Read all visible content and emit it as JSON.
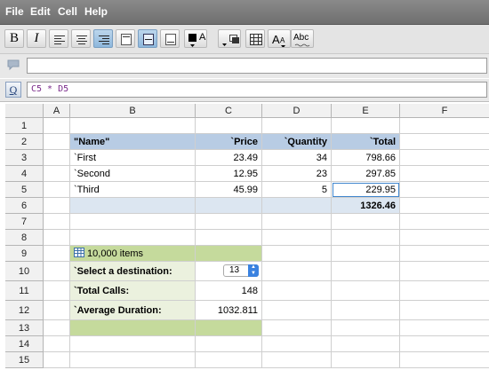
{
  "menu": [
    "File",
    "Edit",
    "Cell",
    "Help"
  ],
  "toolbar": {
    "bold": "B",
    "italic": "I",
    "font_size_label": "A",
    "border_size_label": "A",
    "spell_label": "Abc"
  },
  "formula": "C5 * D5",
  "fx_label": "Q",
  "columns": [
    "A",
    "B",
    "C",
    "D",
    "E",
    "F"
  ],
  "rows": [
    "1",
    "2",
    "3",
    "4",
    "5",
    "6",
    "7",
    "8",
    "9",
    "10",
    "11",
    "12",
    "13",
    "14",
    "15"
  ],
  "table": {
    "headers": {
      "name": "\"Name\"",
      "price": "`Price",
      "quantity": "`Quantity",
      "total": "`Total"
    },
    "items": [
      {
        "name": "`First",
        "price": "23.49",
        "quantity": "34",
        "total": "798.66"
      },
      {
        "name": "`Second",
        "price": "12.95",
        "quantity": "23",
        "total": "297.85"
      },
      {
        "name": "`Third",
        "price": "45.99",
        "quantity": "5",
        "total": "229.95"
      }
    ],
    "grand_total": "1326.46"
  },
  "widget": {
    "title": "10,000 items",
    "destination_label": "`Select a destination:",
    "destination_value": "13",
    "calls_label": "`Total Calls:",
    "calls_value": "148",
    "duration_label": "`Average Duration:",
    "duration_value": "1032.811"
  },
  "colors": {
    "table_header": "#b8cce4",
    "table_footer": "#dce6f1",
    "widget_header": "#c5da9c",
    "widget_body": "#ebf1de",
    "selected_border": "#3f86ce"
  }
}
